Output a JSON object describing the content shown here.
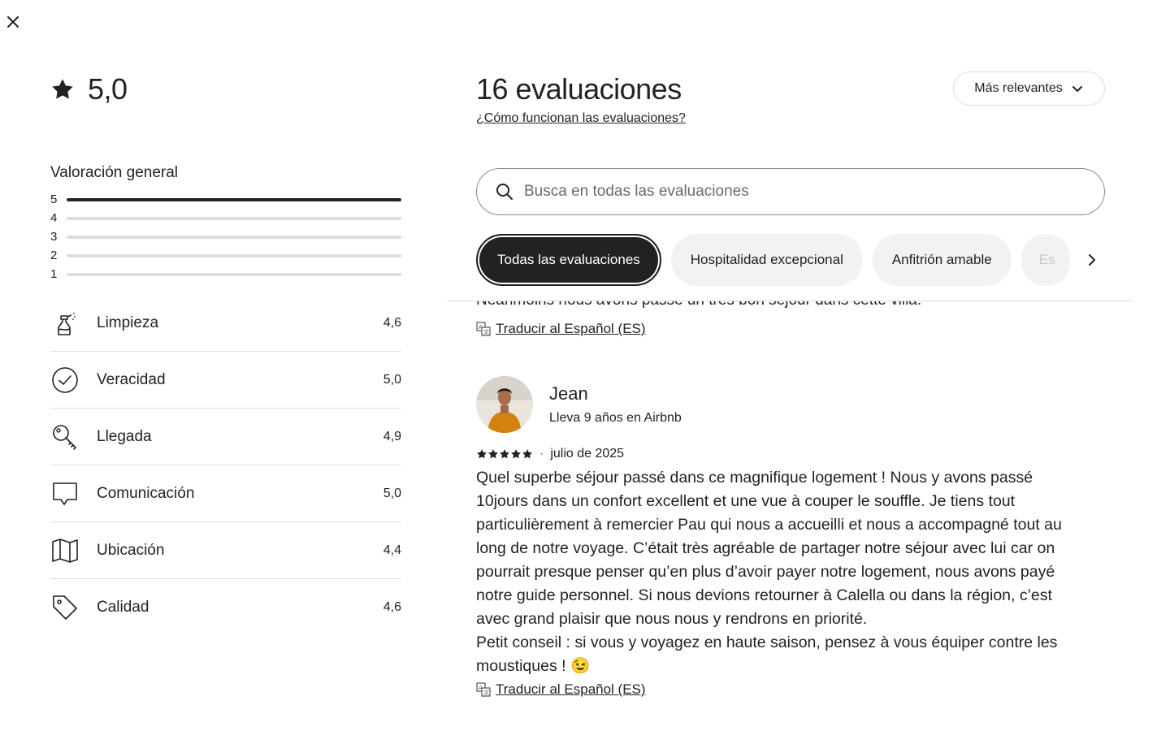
{
  "overall": {
    "rating": "5,0"
  },
  "distribution": {
    "title": "Valoración general",
    "rows": [
      {
        "label": "5",
        "fraction": 1.0
      },
      {
        "label": "4",
        "fraction": 0.0
      },
      {
        "label": "3",
        "fraction": 0.0
      },
      {
        "label": "2",
        "fraction": 0.0
      },
      {
        "label": "1",
        "fraction": 0.0
      }
    ]
  },
  "categories": [
    {
      "icon": "spray-bottle-icon",
      "label": "Limpieza",
      "value": "4,6"
    },
    {
      "icon": "check-circle-icon",
      "label": "Veracidad",
      "value": "5,0"
    },
    {
      "icon": "key-icon",
      "label": "Llegada",
      "value": "4,9"
    },
    {
      "icon": "chat-bubble-icon",
      "label": "Comunicación",
      "value": "5,0"
    },
    {
      "icon": "map-icon",
      "label": "Ubicación",
      "value": "4,4"
    },
    {
      "icon": "tag-icon",
      "label": "Calidad",
      "value": "4,6"
    }
  ],
  "reviews_header": {
    "title": "16 evaluaciones",
    "how_link": "¿Cómo funcionan las evaluaciones?",
    "sort_label": "Más relevantes"
  },
  "search": {
    "placeholder": "Busca en todas las evaluaciones"
  },
  "chips": [
    {
      "label": "Todas las evaluaciones",
      "active": true
    },
    {
      "label": "Hospitalidad excepcional",
      "active": false
    },
    {
      "label": "Anfitrión amable",
      "active": false
    },
    {
      "label": "Es",
      "active": false
    }
  ],
  "previous_review": {
    "cut_text": "Néanmoins nous avons passé un très bon séjour dans cette villa.",
    "translate_label": "Traducir al Español (ES)"
  },
  "review": {
    "name": "Jean",
    "meta": "Lleva 9 años en Airbnb",
    "stars": 5,
    "date": "julio de 2025",
    "body": "Quel superbe séjour passé dans ce magnifique logement ! Nous y avons passé\n10jours dans un confort excellent et une vue à couper le souffle. Je tiens tout\nparticulièrement à remercier Pau qui nous a accueilli et nous a accompagné tout au\nlong de notre voyage. C’était très agréable de partager notre séjour avec lui car on\npourrait presque penser qu’en plus d’avoir payer notre logement, nous avons payé\nnotre guide personnel. Si nous devions retourner à Calella ou dans la région, c’est\navec grand plaisir que nous nous y rendrons en priorité.\nPetit conseil : si vous y voyagez en haute saison, pensez à vous équiper contre les\nmoustiques ! 😉",
    "translate_label": "Traducir al Español (ES)"
  },
  "colors": {
    "text": "#222222",
    "track": "#dddddd",
    "fill": "#222222",
    "chip_bg": "#f2f2f2"
  }
}
